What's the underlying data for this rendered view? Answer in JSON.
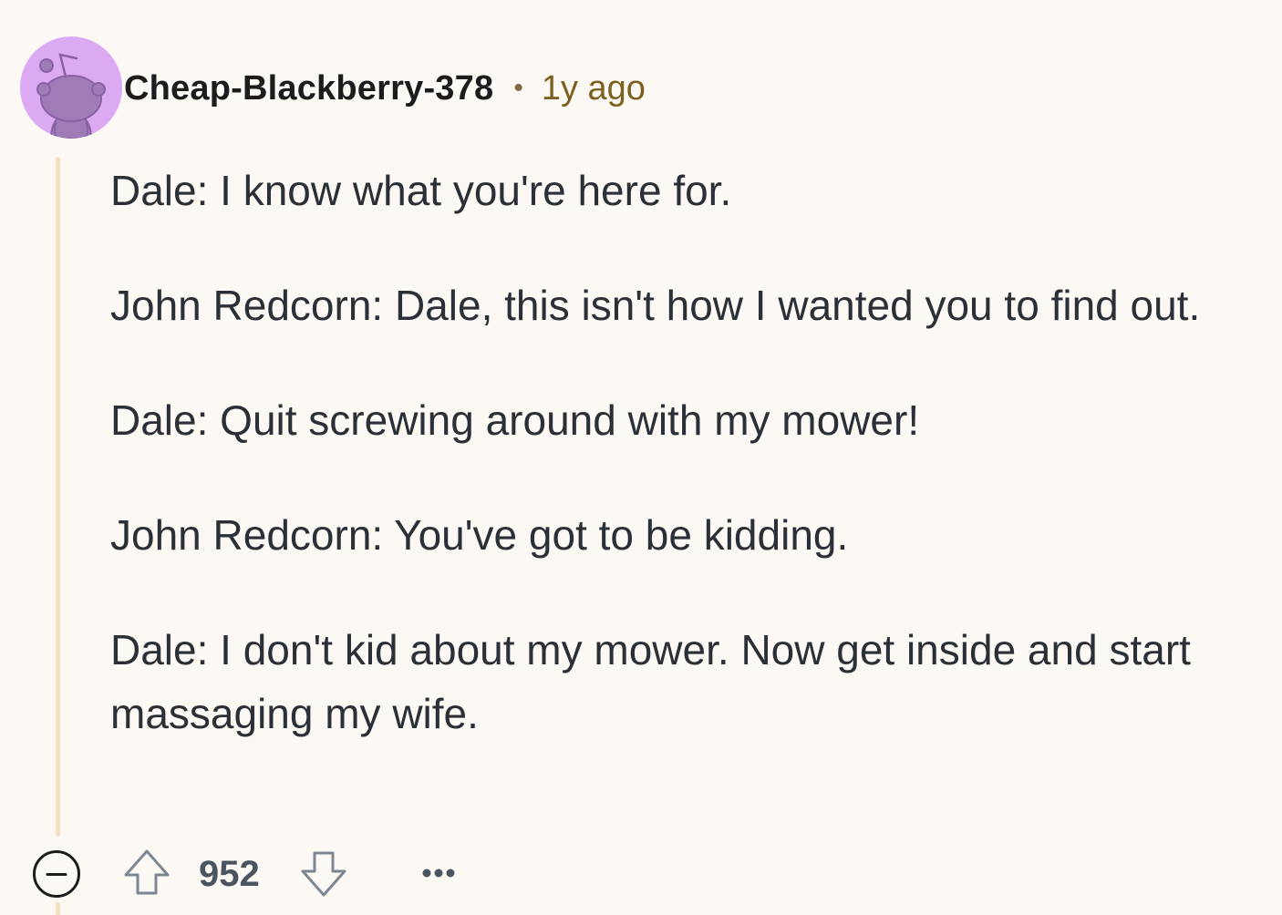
{
  "comment": {
    "author": "Cheap-Blackberry-378",
    "separator": "•",
    "timestamp": "1y ago",
    "avatar_icon": "snoo-avatar-icon",
    "avatar_color": "#dcaaf2",
    "paragraphs": [
      "Dale: I know what you're here for.",
      "John Redcorn: Dale, this isn't how I wanted you to find out.",
      "Dale: Quit screwing around with my mower!",
      "John Redcorn: You've got to be kidding.",
      "Dale: I don't kid about my mower. Now get inside and start massaging my wife."
    ],
    "score": "952"
  },
  "actions": {
    "collapse_icon": "collapse-minus-icon",
    "upvote_icon": "upvote-arrow-icon",
    "downvote_icon": "downvote-arrow-icon",
    "more_icon": "more-options-icon"
  },
  "colors": {
    "background": "#fcf9f5",
    "thread_line": "#f5dfc4",
    "text": "#2b3036",
    "timestamp": "#7d5f1f"
  }
}
